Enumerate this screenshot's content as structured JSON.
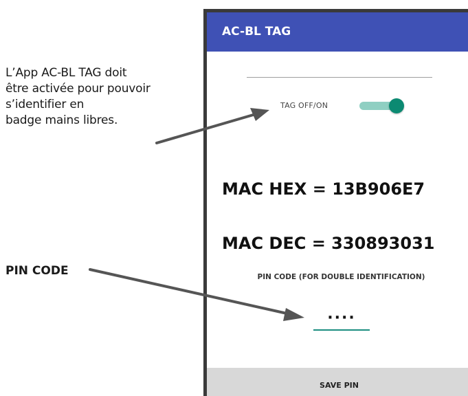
{
  "app": {
    "title": "AC-BL TAG",
    "accent_color": "#3f51b5"
  },
  "annotations": {
    "tag_note_lines": [
      "L’App AC-BL TAG doit",
      "être activée  pour pouvoir",
      "s’identifier en",
      "badge mains libres."
    ],
    "pin_note": "PIN CODE"
  },
  "tag_toggle": {
    "label": "TAG OFF/ON",
    "state": "on",
    "track_color": "#8fcfc2",
    "thumb_color": "#0c8a72"
  },
  "mac": {
    "hex_line": "MAC HEX = 13B906E7",
    "dec_line": "MAC DEC = 330893031"
  },
  "pin": {
    "caption": "PIN CODE (FOR DOUBLE IDENTIFICATION)",
    "value": "····"
  },
  "buttons": {
    "save_label": "SAVE PIN"
  }
}
